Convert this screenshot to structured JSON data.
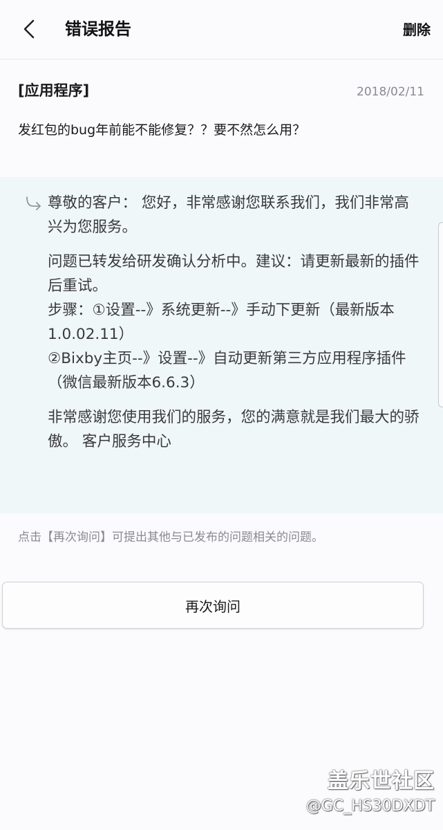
{
  "header": {
    "back_icon": "chevron-left-icon",
    "title": "错误报告",
    "delete_label": "删除"
  },
  "report": {
    "category": "[应用程序]",
    "date": "2018/02/11",
    "question": "发红包的bug年前能不能修复？？要不然怎么用？"
  },
  "reply": {
    "icon": "reply-arrow-icon",
    "paragraph_1": "尊敬的客户： 您好，非常感谢您联系我们，我们非常高兴为您服务。",
    "paragraph_2": "问题已转发给研发确认分析中。建议：请更新最新的插件后重试。\n步骤：①设置--》系统更新--》手动下更新（最新版本1.0.02.11）\n②Bixby主页--》设置--》自动更新第三方应用程序插件（微信最新版本6.6.3）",
    "paragraph_3": "非常感谢您使用我们的服务，您的满意就是我们最大的骄傲。 客户服务中心"
  },
  "hint": "点击【再次询问】可提出其他与已发布的问题相关的问题。",
  "ask_again_label": "再次询问",
  "watermark": {
    "title": "盖乐世社区",
    "handle": "@GC_HS30DXDT"
  },
  "colors": {
    "background": "#fbfafd",
    "reply_background": "#f0f7f8",
    "secondary_text": "#8a8a8f"
  }
}
